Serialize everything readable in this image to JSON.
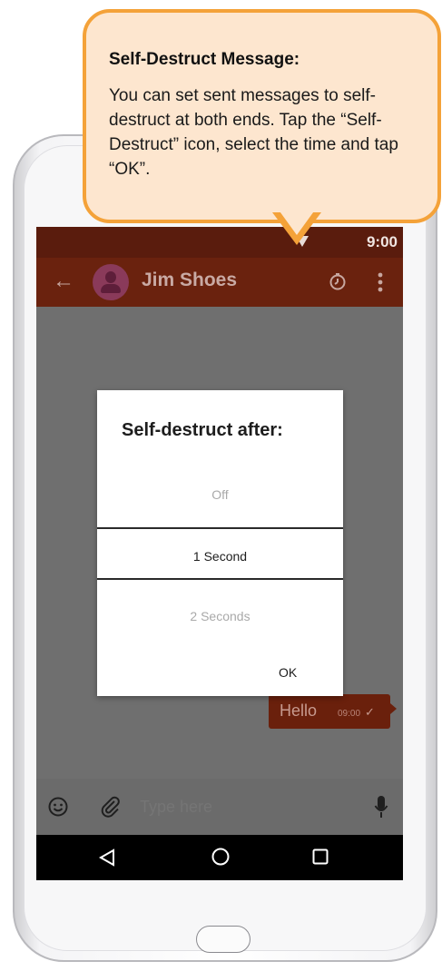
{
  "callout": {
    "title": "Self-Destruct Message:",
    "body": "You can set sent messages to self-destruct at both ends. Tap the “Self-Destruct” icon, select the time and tap “OK”."
  },
  "status_bar": {
    "time": "9:00"
  },
  "app_bar": {
    "contact_name": "Jim Shoes",
    "icons": [
      "back-arrow-icon",
      "avatar",
      "timer-icon",
      "more-vertical-icon"
    ]
  },
  "dialog": {
    "title": "Self-destruct after:",
    "options": [
      "Off",
      "1 Second",
      "2 Seconds"
    ],
    "selected": "1 Second",
    "ok_label": "OK"
  },
  "message": {
    "text": "Hello",
    "time": "09:00",
    "status_icon": "check-icon"
  },
  "input_bar": {
    "placeholder": "Type here",
    "icons": [
      "emoji-icon",
      "attach-icon",
      "mic-icon"
    ]
  },
  "nav_bar": {
    "icons": [
      "nav-back-icon",
      "nav-home-icon",
      "nav-recent-icon"
    ]
  },
  "colors": {
    "callout_border": "#f4a239",
    "callout_fill": "#fde6cf",
    "app_bar": "#6a220e",
    "status_bar": "#5a1c0d",
    "overlay": "#6f6f6f"
  }
}
